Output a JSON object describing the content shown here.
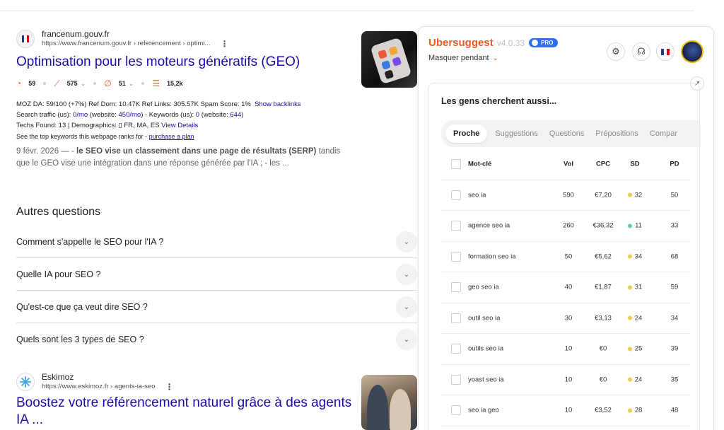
{
  "result1": {
    "site_name": "francenum.gouv.fr",
    "site_url": "https://www.francenum.gouv.fr › referencement › optimi...",
    "title": "Optimisation pour les moteurs génératifs (GEO)",
    "metrics": [
      "59",
      "575",
      "51",
      "15,2k"
    ],
    "moz_prefix": "MOZ DA: 59/100 (+7%)   Ref Dom: 10.47K   Ref Links: 305.57K   Spam Score: 1%",
    "show_backlinks": "Show backlinks",
    "traffic_prefix": "Search traffic (us): ",
    "traffic_us": "0/mo",
    "traffic_mid": " (website: ",
    "traffic_site": "450/mo",
    "keywords_mid": ") - Keywords (us): ",
    "keywords_us": "0",
    "keywords_mid2": " (website: ",
    "keywords_site": "644",
    "keywords_end": ")",
    "techs": "Techs Found: 13 | Demographics:  ▯ FR, MA, ES ",
    "view_details": "View Details",
    "see_top": "See the top keywords this webpage ranks for - ",
    "purchase": "purchase a plan",
    "snippet_date": "9 févr. 2026 — - ",
    "snippet_bold": "le SEO vise un classement dans une page de résultats (SERP)",
    "snippet_rest": " tandis que le GEO vise une intégration dans une réponse générée par l'IA ; - les ..."
  },
  "paa": {
    "title": "Autres questions",
    "items": [
      "Comment s'appelle le SEO pour l'IA ?",
      "Quelle IA pour SEO ?",
      "Qu'est-ce que ça veut dire SEO ?",
      "Quels sont les 3 types de SEO ?"
    ]
  },
  "result2": {
    "site_name": "Eskimoz",
    "site_url": "https://www.eskimoz.fr › agents-ia-seo",
    "title": "Boostez votre référencement naturel grâce à des agents IA ..."
  },
  "ubersuggest": {
    "name": "Ubersuggest",
    "version": "v4.0.33",
    "pro": "PRO",
    "hide": "Masquer pendant",
    "card_title": "Les gens cherchent aussi...",
    "tabs": [
      "Proche",
      "Suggestions",
      "Questions",
      "Prépositions",
      "Compar"
    ],
    "headers": {
      "keyword": "Mot-clé",
      "vol": "Vol",
      "cpc": "CPC",
      "sd": "SD",
      "pd": "PD"
    },
    "rows": [
      {
        "kw": "seo ia",
        "vol": "590",
        "cpc": "€7,20",
        "sd": "32",
        "sd_color": "#f2c94c",
        "pd": "50"
      },
      {
        "kw": "agence seo ia",
        "vol": "260",
        "cpc": "€36,32",
        "sd": "11",
        "sd_color": "#5ad1a8",
        "pd": "33"
      },
      {
        "kw": "formation seo ia",
        "vol": "50",
        "cpc": "€5,62",
        "sd": "34",
        "sd_color": "#f2c94c",
        "pd": "68"
      },
      {
        "kw": "geo seo ia",
        "vol": "40",
        "cpc": "€1,87",
        "sd": "31",
        "sd_color": "#f2c94c",
        "pd": "59"
      },
      {
        "kw": "outil seo ia",
        "vol": "30",
        "cpc": "€3,13",
        "sd": "24",
        "sd_color": "#f2c94c",
        "pd": "34"
      },
      {
        "kw": "outils seo ia",
        "vol": "10",
        "cpc": "€0",
        "sd": "25",
        "sd_color": "#f2c94c",
        "pd": "39"
      },
      {
        "kw": "yoast seo ia",
        "vol": "10",
        "cpc": "€0",
        "sd": "24",
        "sd_color": "#f2c94c",
        "pd": "35"
      },
      {
        "kw": "seo ia geo",
        "vol": "10",
        "cpc": "€3,52",
        "sd": "28",
        "sd_color": "#f2c94c",
        "pd": "48"
      }
    ]
  }
}
